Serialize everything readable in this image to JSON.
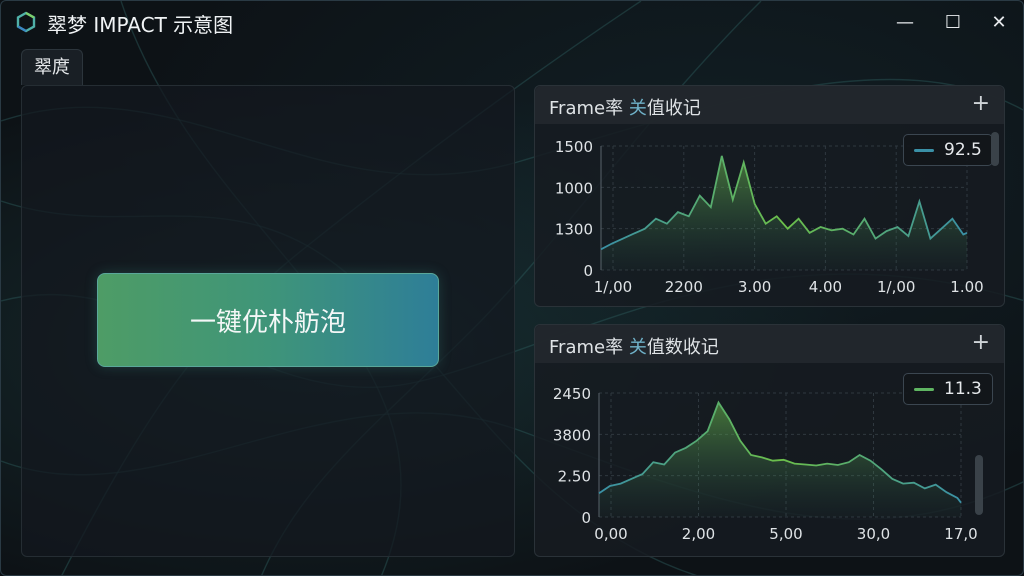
{
  "window": {
    "title": "翠梦 IMPACT 示意图",
    "controls": {
      "minimize": "—",
      "maximize": "☐",
      "close": "✕"
    }
  },
  "tab": {
    "label": "翠庹"
  },
  "main": {
    "action_button_label": "一键优朴舫泡"
  },
  "colors": {
    "green": "#5fb562",
    "teal": "#3a90a6",
    "accent_text": "#6fb1c8"
  },
  "panels": [
    {
      "title_prefix": "Frame率",
      "title_accent": "关",
      "title_suffix": "值收记",
      "add_label": "+",
      "legend_value": "92.5"
    },
    {
      "title_prefix": "Frame率",
      "title_accent": "关",
      "title_suffix": "值数收记",
      "add_label": "+",
      "legend_value": "11.3"
    }
  ],
  "chart_data": [
    {
      "type": "line",
      "y_tick_labels": [
        "1500",
        "1000",
        "1300",
        "0"
      ],
      "x_tick_labels": [
        "1/,00",
        "2200",
        "3.00",
        "4.00",
        "1/,00",
        "1.00"
      ],
      "legend": "92.5",
      "x": [
        0,
        3,
        6,
        9,
        12,
        15,
        18,
        21,
        24,
        27,
        30,
        33,
        36,
        39,
        42,
        45,
        48,
        51,
        54,
        57,
        60,
        63,
        66,
        69,
        72,
        75,
        78,
        81,
        84,
        87,
        90,
        93,
        96,
        99,
        100
      ],
      "values": [
        250,
        320,
        380,
        440,
        500,
        620,
        560,
        700,
        650,
        900,
        760,
        1380,
        850,
        1300,
        800,
        560,
        650,
        500,
        620,
        450,
        520,
        480,
        500,
        430,
        620,
        380,
        470,
        520,
        410,
        830,
        380,
        500,
        620,
        430,
        450
      ],
      "ylim": [
        0,
        1500
      ]
    },
    {
      "type": "area",
      "y_tick_labels": [
        "2450",
        "3800",
        "2.50",
        "0"
      ],
      "x_tick_labels": [
        "0,00",
        "2,00",
        "5,00",
        "30,0",
        "17,0"
      ],
      "legend": "11.3",
      "x": [
        0,
        3,
        6,
        9,
        12,
        15,
        18,
        21,
        24,
        27,
        30,
        33,
        36,
        39,
        42,
        45,
        48,
        51,
        54,
        57,
        60,
        63,
        66,
        69,
        72,
        75,
        78,
        81,
        84,
        87,
        90,
        93,
        96,
        99,
        100
      ],
      "values": [
        500,
        650,
        700,
        800,
        900,
        1150,
        1100,
        1350,
        1450,
        1600,
        1800,
        2400,
        2050,
        1600,
        1300,
        1250,
        1180,
        1200,
        1120,
        1100,
        1080,
        1120,
        1090,
        1150,
        1300,
        1180,
        1000,
        800,
        700,
        720,
        600,
        680,
        520,
        400,
        300
      ],
      "ylim": [
        0,
        2600
      ]
    }
  ]
}
